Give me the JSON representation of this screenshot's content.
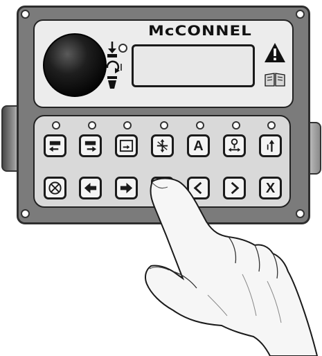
{
  "brand": {
    "name": "McCONNEL"
  },
  "keys": {
    "top_row": [
      {
        "icon": "boom-float-left-icon"
      },
      {
        "icon": "boom-float-right-icon"
      },
      {
        "icon": "rotor-mode-icon"
      },
      {
        "icon": "axis-control-icon"
      },
      {
        "icon": "auto-mode-icon",
        "label": "A"
      },
      {
        "icon": "joystick-icon"
      },
      {
        "icon": "lift-icon"
      }
    ],
    "bottom_row": [
      {
        "icon": "reset-icon"
      },
      {
        "icon": "arrow-left-icon"
      },
      {
        "icon": "arrow-right-icon"
      },
      {
        "icon": "hidden-key-icon"
      },
      {
        "icon": "chevron-left-icon"
      },
      {
        "icon": "chevron-right-icon"
      },
      {
        "icon": "cancel-icon",
        "label": "X"
      }
    ]
  },
  "icons": [
    "warning-icon",
    "manual-book-icon",
    "rotor-down-icon",
    "rotor-rotate-icon",
    "pointing-hand"
  ],
  "colors": {
    "housing": "#7b7b7b",
    "panel": "#ececec",
    "key": "#f4f4f4",
    "outline": "#1b1b1b"
  }
}
